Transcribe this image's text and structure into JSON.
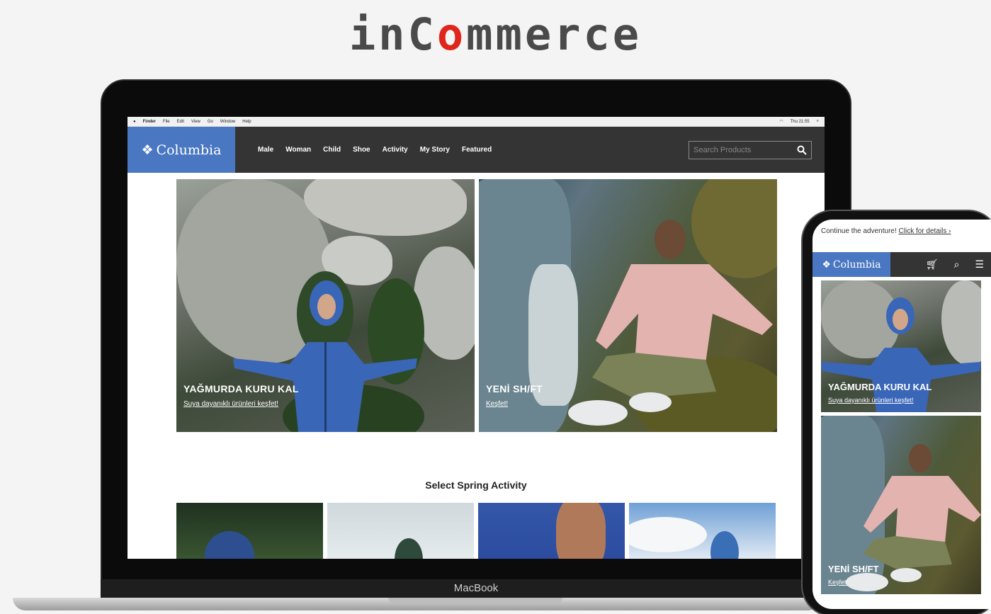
{
  "brand": {
    "prefix": "inC",
    "accent": "o",
    "suffix": "mmerce",
    "accent_color": "#e0251b"
  },
  "laptop": {
    "label": "MacBook"
  },
  "mac_menubar": {
    "items": [
      "Finder",
      "File",
      "Edit",
      "View",
      "Go",
      "Window",
      "Help"
    ],
    "status": "Thu 21:55"
  },
  "site": {
    "logo": "Columbia",
    "logo_icon": "diamond-icon",
    "nav": [
      "Male",
      "Woman",
      "Child",
      "Shoe",
      "Activity",
      "My Story",
      "Featured"
    ],
    "search_placeholder": "Search Products",
    "hero": [
      {
        "title": "YAĞMURDA KURU KAL",
        "link": "Suya dayanıklı ürünleri keşfet!"
      },
      {
        "title": "YENİ SH/FT",
        "link": "Keşfet!"
      }
    ],
    "section_title": "Select Spring Activity"
  },
  "mobile": {
    "promo_text": "Continue the adventure!",
    "promo_link": "Click for details ›",
    "logo": "Columbia",
    "icons": [
      "cart-icon",
      "search-icon",
      "menu-icon"
    ],
    "hero": [
      {
        "title": "YAĞMURDA KURU KAL",
        "link": "Suya dayanıklı ürünleri keşfet!"
      },
      {
        "title": "YENİ SH/FT",
        "link": "Keşfet!"
      }
    ]
  }
}
